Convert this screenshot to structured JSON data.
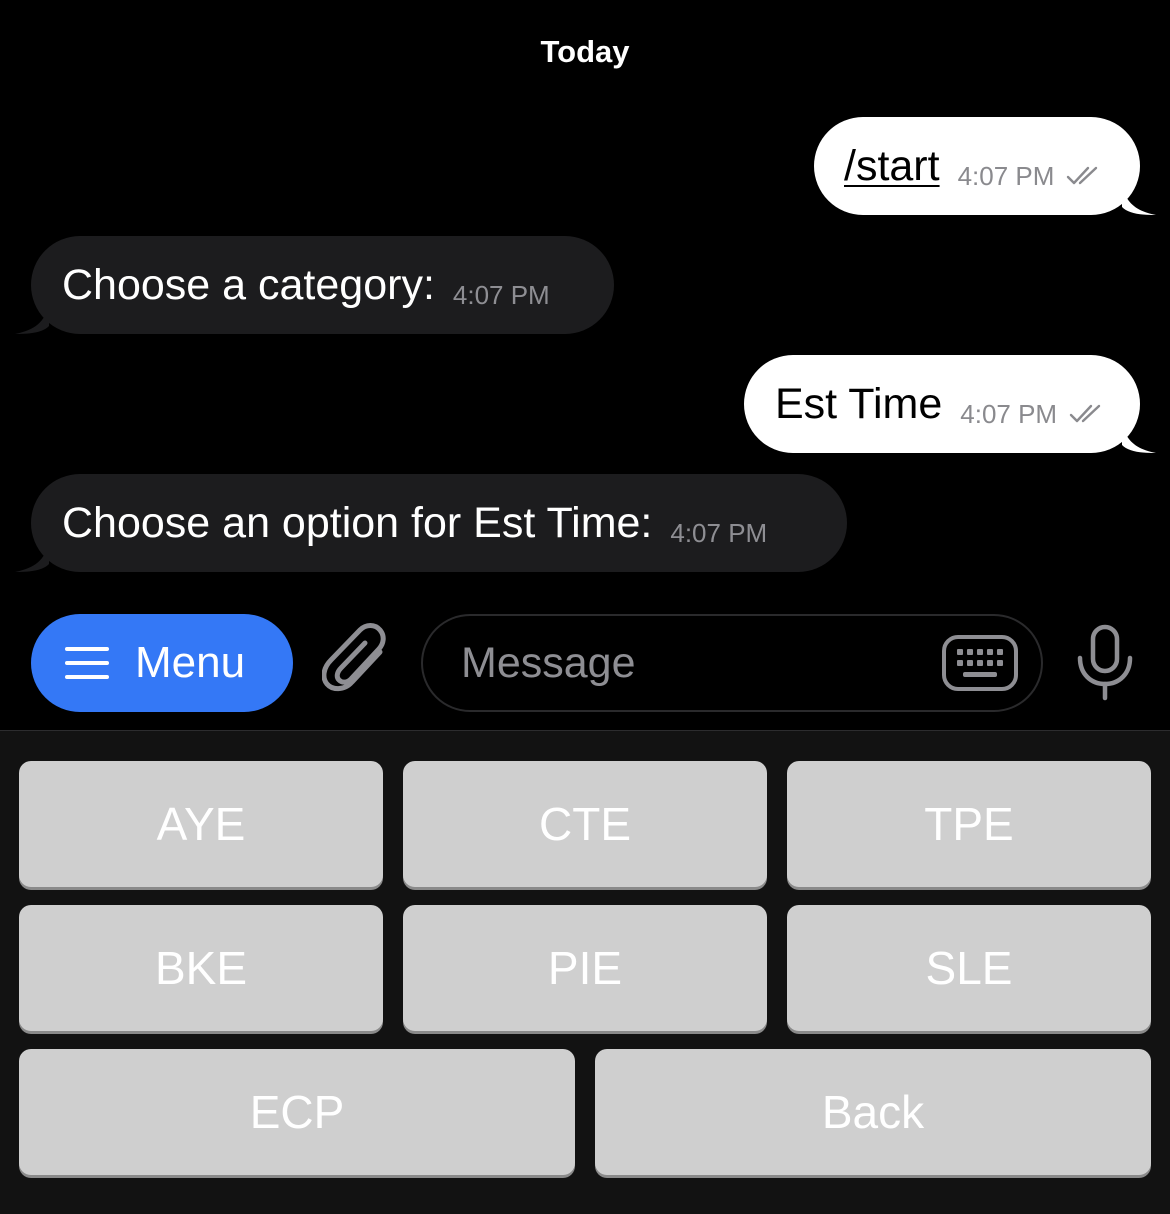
{
  "chat": {
    "date_header": "Today",
    "messages": [
      {
        "direction": "out",
        "text": "/start",
        "time": "4:07 PM",
        "status": "read"
      },
      {
        "direction": "in",
        "text": "Choose a category:",
        "time": "4:07 PM"
      },
      {
        "direction": "out",
        "text": "Est Time",
        "time": "4:07 PM",
        "status": "read"
      },
      {
        "direction": "in",
        "text": "Choose an option for Est Time:",
        "time": "4:07 PM"
      }
    ]
  },
  "composer": {
    "menu_label": "Menu",
    "message_placeholder": "Message",
    "icons": {
      "menu": "hamburger-icon",
      "attach": "paperclip-icon",
      "keyboard": "keyboard-icon",
      "mic": "microphone-icon"
    }
  },
  "keyboard": {
    "buttons": [
      "AYE",
      "CTE",
      "TPE",
      "BKE",
      "PIE",
      "SLE",
      "ECP",
      "Back"
    ]
  },
  "colors": {
    "background": "#000000",
    "incoming_bubble": "#1c1c1e",
    "outgoing_bubble": "#ffffff",
    "accent": "#3478f6",
    "keyboard_button": "#cfcfcf",
    "keyboard_panel": "#121212"
  }
}
